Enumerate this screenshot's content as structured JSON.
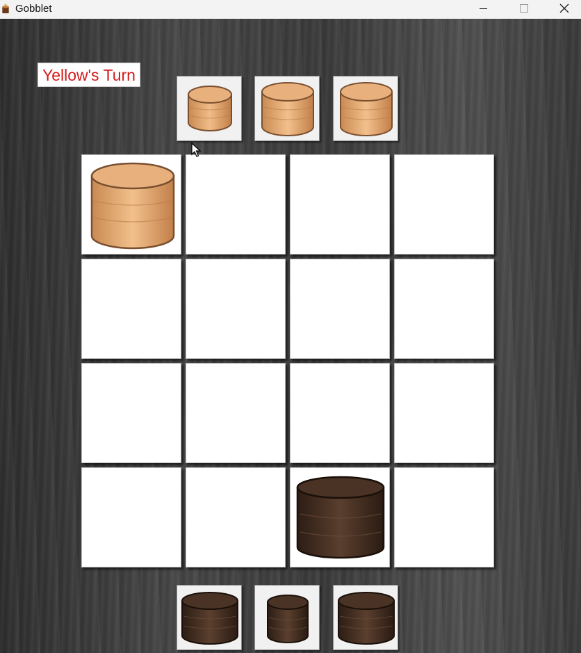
{
  "window": {
    "title": "Gobblet",
    "icon": "gobblet-app-icon",
    "controls": [
      "minimize-icon",
      "maximize-icon",
      "close-icon"
    ]
  },
  "status": {
    "turn_text": "Yellow's Turn",
    "turn_color": "#d41a1a"
  },
  "colors": {
    "light_piece": "#dca06a",
    "dark_piece": "#3e2a1e",
    "cell_bg": "#ffffff",
    "tray_bg": "#f1f1f1"
  },
  "top_tray": {
    "player": "light",
    "pieces": [
      "medium",
      "large",
      "large"
    ]
  },
  "bottom_tray": {
    "player": "dark",
    "pieces": [
      "large",
      "medium",
      "large"
    ]
  },
  "board": {
    "rows": 4,
    "cols": 4,
    "cells": [
      [
        {
          "piece": "light",
          "size": "large"
        },
        null,
        null,
        null
      ],
      [
        null,
        null,
        null,
        null
      ],
      [
        null,
        null,
        null,
        null
      ],
      [
        null,
        null,
        {
          "piece": "dark",
          "size": "large"
        },
        null
      ]
    ]
  }
}
